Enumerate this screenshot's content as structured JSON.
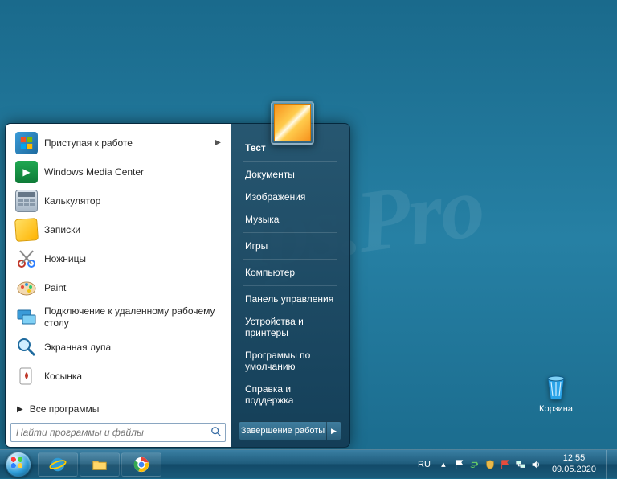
{
  "desktop": {
    "recycle_bin_label": "Корзина"
  },
  "watermark": "Fraps.Pro",
  "start_menu": {
    "programs": [
      {
        "label": "Приступая к работе",
        "has_submenu": true,
        "icon": "getting-started"
      },
      {
        "label": "Windows Media Center",
        "has_submenu": false,
        "icon": "media-center"
      },
      {
        "label": "Калькулятор",
        "has_submenu": false,
        "icon": "calculator"
      },
      {
        "label": "Записки",
        "has_submenu": false,
        "icon": "sticky-notes"
      },
      {
        "label": "Ножницы",
        "has_submenu": false,
        "icon": "snipping-tool"
      },
      {
        "label": "Paint",
        "has_submenu": false,
        "icon": "paint"
      },
      {
        "label": "Подключение к удаленному рабочему столу",
        "has_submenu": false,
        "icon": "remote-desktop"
      },
      {
        "label": "Экранная лупа",
        "has_submenu": false,
        "icon": "magnifier"
      },
      {
        "label": "Косынка",
        "has_submenu": false,
        "icon": "solitaire"
      }
    ],
    "all_programs_label": "Все программы",
    "search_placeholder": "Найти программы и файлы",
    "right_items": [
      {
        "label": "Тест",
        "bold": true,
        "sep_after": true
      },
      {
        "label": "Документы",
        "bold": false,
        "sep_after": false
      },
      {
        "label": "Изображения",
        "bold": false,
        "sep_after": false
      },
      {
        "label": "Музыка",
        "bold": false,
        "sep_after": true
      },
      {
        "label": "Игры",
        "bold": false,
        "sep_after": true
      },
      {
        "label": "Компьютер",
        "bold": false,
        "sep_after": true
      },
      {
        "label": "Панель управления",
        "bold": false,
        "sep_after": false
      },
      {
        "label": "Устройства и принтеры",
        "bold": false,
        "sep_after": false
      },
      {
        "label": "Программы по умолчанию",
        "bold": false,
        "sep_after": false
      },
      {
        "label": "Справка и поддержка",
        "bold": false,
        "sep_after": false
      }
    ],
    "shutdown_label": "Завершение работы"
  },
  "taskbar": {
    "pinned": [
      {
        "name": "ie",
        "title": "Internet Explorer"
      },
      {
        "name": "explorer",
        "title": "Проводник"
      },
      {
        "name": "chrome",
        "title": "Google Chrome"
      }
    ],
    "lang": "RU",
    "tray_icons": [
      "flag-icon",
      "power-icon",
      "shield-icon",
      "action-center-icon",
      "network-icon",
      "volume-icon"
    ],
    "clock_time": "12:55",
    "clock_date": "09.05.2020"
  }
}
